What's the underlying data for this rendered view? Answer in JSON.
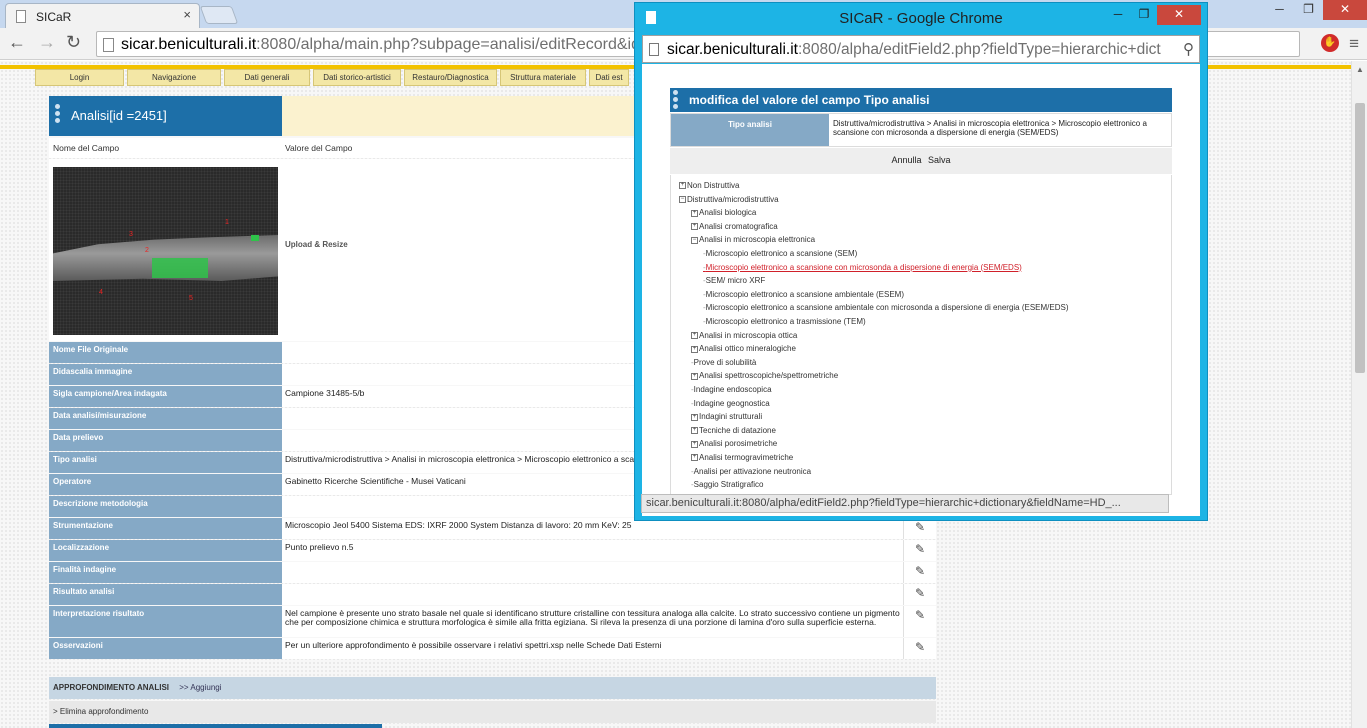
{
  "browser": {
    "tab_title": "SICaR",
    "tab_close": "×",
    "url_host": "sicar.beniculturali.it",
    "url_rest": ":8080/alpha/main.php?subpage=analisi/editRecord&id",
    "back": "←",
    "forward": "→",
    "reload": "↻",
    "stop": "✋",
    "menu": "≡",
    "window_buttons": {
      "minimize": "─",
      "maximize": "❐",
      "close": "✕"
    }
  },
  "nav_menu": [
    "Login",
    "Navigazione",
    "Dati generali",
    "Dati storico-artistici",
    "Restauro/Diagnostica",
    "Struttura materiale",
    "Dati est"
  ],
  "record": {
    "title": "Analisi[id =2451]",
    "col_name_header": "Nome del Campo",
    "col_value_header": "Valore del Campo",
    "upload_label": "Upload & Resize",
    "image_marks": [
      "1",
      "2",
      "3",
      "4",
      "5"
    ],
    "rows": [
      {
        "label": "Nome File Originale",
        "value": ""
      },
      {
        "label": "Didascalia immagine",
        "value": ""
      },
      {
        "label": "Sigla campione/Area indagata",
        "value": "Campione 31485-5/b"
      },
      {
        "label": "Data analisi/misurazione",
        "value": ""
      },
      {
        "label": "Data prelievo",
        "value": ""
      },
      {
        "label": "Tipo analisi",
        "value": "Distruttiva/microdistruttiva > Analisi in microscopia elettronica > Microscopio elettronico a scansione"
      },
      {
        "label": "Operatore",
        "value": "Gabinetto Ricerche Scientifiche - Musei Vaticani"
      },
      {
        "label": "Descrizione metodologia",
        "value": ""
      },
      {
        "label": "Strumentazione",
        "value": "Microscopio Jeol 5400 Sistema EDS: IXRF 2000 System Distanza di lavoro: 20 mm KeV: 25"
      },
      {
        "label": "Localizzazione",
        "value": "Punto prelievo n.5"
      },
      {
        "label": "Finalità indagine",
        "value": ""
      },
      {
        "label": "Risultato analisi",
        "value": ""
      },
      {
        "label": "Interpretazione risultato",
        "value": "Nel campione è presente uno strato basale nel quale si identificano strutture cristalline con tessitura analoga alla calcite. Lo strato successivo contiene un pigmento che per composizione chimica e struttura morfologica è simile alla fritta egiziana. Si rileva la presenza di una porzione di lamina d'oro sulla superficie esterna."
      },
      {
        "label": "Osservazioni",
        "value": "Per un ulteriore approfondimento è possibile osservare i relativi spettri.xsp nelle Schede Dati Esterni"
      }
    ],
    "edit_icon": "✎",
    "approfondimento_title": "APPROFONDIMENTO ANALISI",
    "approfondimento_add": ">> Aggiungi",
    "elimina": "> Elimina approfondimento"
  },
  "popup": {
    "window_title": "SICaR - Google Chrome",
    "url_host": "sicar.beniculturali.it",
    "url_rest": ":8080/alpha/editField2.php?fieldType=hierarchic+dict",
    "zoom": "⚲",
    "box_title": "modifica del valore del campo Tipo analisi",
    "field_label": "Tipo analisi",
    "field_value": "Distruttiva/microdistruttiva > Analisi in microscopia elettronica > Microscopio elettronico a scansione con microsonda a dispersione di energia (SEM/EDS)",
    "cancel": "Annulla",
    "save": "Salva",
    "status_url": "sicar.beniculturali.it:8080/alpha/editField2.php?fieldType=hierarchic+dictionary&fieldName=HD_..."
  },
  "tree": [
    {
      "label": "Non Distruttiva",
      "expander": "+"
    },
    {
      "label": "Distruttiva/microdistruttiva",
      "expander": "−"
    },
    {
      "label": "Analisi biologica",
      "expander": "+"
    },
    {
      "label": "Analisi cromatografica",
      "expander": "+"
    },
    {
      "label": "Analisi in microscopia elettronica",
      "expander": "−"
    },
    {
      "label": "Microscopio elettronico a scansione (SEM)",
      "expander": ""
    },
    {
      "label": "Microscopio elettronico a scansione con microsonda a dispersione di energia (SEM/EDS)",
      "expander": "",
      "selected": true
    },
    {
      "label": "SEM/ micro XRF",
      "expander": ""
    },
    {
      "label": "Microscopio elettronico a scansione ambientale (ESEM)",
      "expander": ""
    },
    {
      "label": "Microscopio elettronico a scansione ambientale con microsonda a dispersione di energia (ESEM/EDS)",
      "expander": ""
    },
    {
      "label": "Microscopio elettronico a trasmissione (TEM)",
      "expander": ""
    },
    {
      "label": "Analisi in microscopia ottica",
      "expander": "+"
    },
    {
      "label": "Analisi ottico mineralogiche",
      "expander": "+"
    },
    {
      "label": "Prove di solubilità",
      "expander": ""
    },
    {
      "label": "Analisi spettroscopiche/spettrometriche",
      "expander": "+"
    },
    {
      "label": "Indagine endoscopica",
      "expander": ""
    },
    {
      "label": "Indagine geognostica",
      "expander": ""
    },
    {
      "label": "Indagini strutturali",
      "expander": "+"
    },
    {
      "label": "Tecniche di datazione",
      "expander": "+"
    },
    {
      "label": "Analisi porosimetriche",
      "expander": "+"
    },
    {
      "label": "Analisi termogravimetriche",
      "expander": "+"
    },
    {
      "label": "Analisi per attivazione neutronica",
      "expander": ""
    },
    {
      "label": "Saggio Stratigrafico",
      "expander": ""
    }
  ]
}
